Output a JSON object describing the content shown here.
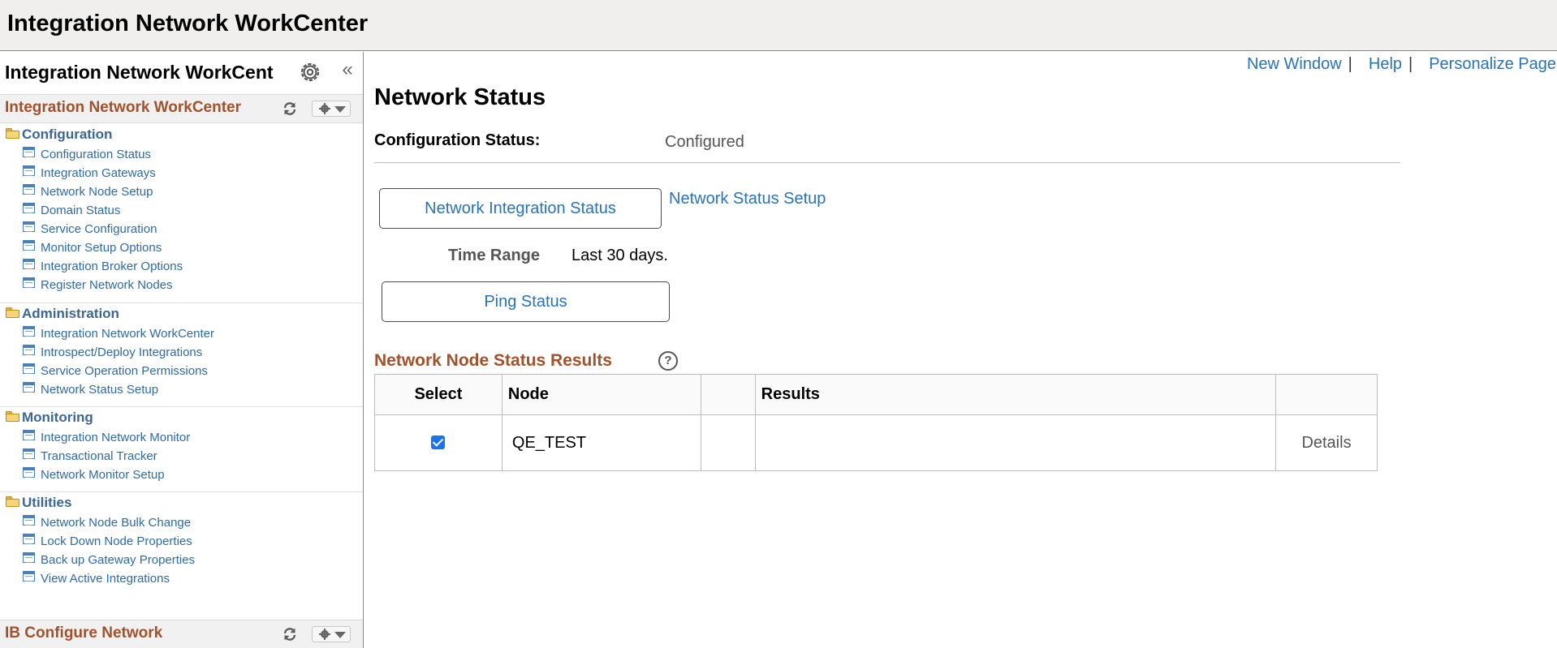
{
  "banner": {
    "title": "Integration Network WorkCenter"
  },
  "left_panel": {
    "title": "Integration Network WorkCent",
    "pagelet_title": "Integration Network WorkCenter",
    "groups": [
      {
        "label": "Configuration",
        "items": [
          "Configuration Status",
          "Integration Gateways",
          "Network Node Setup",
          "Domain Status",
          "Service Configuration",
          "Monitor Setup Options",
          "Integration Broker Options",
          "Register Network Nodes"
        ]
      },
      {
        "label": "Administration",
        "items": [
          "Integration Network WorkCenter",
          "Introspect/Deploy Integrations",
          "Service Operation Permissions",
          "Network Status Setup"
        ]
      },
      {
        "label": "Monitoring",
        "items": [
          "Integration Network Monitor",
          "Transactional Tracker",
          "Network Monitor Setup"
        ]
      },
      {
        "label": "Utilities",
        "items": [
          "Network Node Bulk Change",
          "Lock Down Node Properties",
          "Back up Gateway Properties",
          "View Active Integrations"
        ]
      }
    ],
    "bottom_pagelet_title": "IB Configure Network"
  },
  "top_links": {
    "new_window": "New Window",
    "help": "Help",
    "personalize": "Personalize Page",
    "separator": "|"
  },
  "main": {
    "title": "Network Status",
    "config_status_label": "Configuration Status:",
    "config_status_value": "Configured",
    "network_integration_status_button": "Network Integration Status",
    "network_status_setup_link": "Network Status Setup",
    "time_range_label": "Time Range",
    "time_range_value": "Last 30 days.",
    "ping_status_button": "Ping Status",
    "grid_title": "Network Node Status Results",
    "help_icon_glyph": "?",
    "grid": {
      "columns": [
        "Select",
        "Node",
        "",
        "Results",
        ""
      ],
      "rows": [
        {
          "selected": true,
          "node": "QE_TEST",
          "results": "",
          "details": "Details"
        }
      ]
    }
  },
  "colors": {
    "accent_link": "#2a73b5",
    "pagelet_title": "#a0522d",
    "group_label": "#3c6693",
    "checkbox": "#1a73e8"
  }
}
